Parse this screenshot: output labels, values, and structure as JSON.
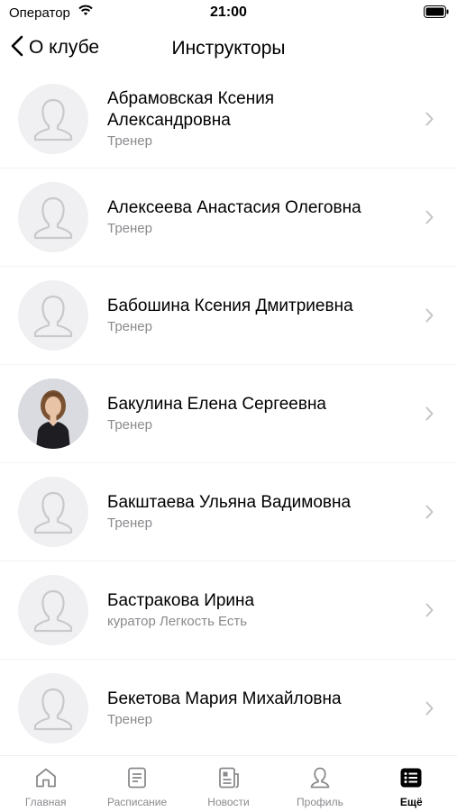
{
  "status_bar": {
    "carrier": "Оператор",
    "time": "21:00"
  },
  "nav": {
    "back_label": "О клубе",
    "title": "Инструкторы"
  },
  "instructors": [
    {
      "name_line1": "Абрамовская Ксения",
      "name_line2": "Александровна",
      "role": "Тренер",
      "avatar": "placeholder-person-icon"
    },
    {
      "name_line1": "Алексеева Анастасия Олеговна",
      "name_line2": "",
      "role": "Тренер",
      "avatar": "placeholder-person-icon"
    },
    {
      "name_line1": "Бабошина Ксения Дмитриевна",
      "name_line2": "",
      "role": "Тренер",
      "avatar": "placeholder-person-icon"
    },
    {
      "name_line1": "Бакулина Елена Сергеевна",
      "name_line2": "",
      "role": "Тренер",
      "avatar": "photo"
    },
    {
      "name_line1": "Бакштаева Ульяна Вадимовна",
      "name_line2": "",
      "role": "Тренер",
      "avatar": "placeholder-person-icon"
    },
    {
      "name_line1": "Бастракова Ирина",
      "name_line2": "",
      "role": "куратор Легкость Есть",
      "avatar": "placeholder-person-icon"
    },
    {
      "name_line1": "Бекетова Мария Михайловна",
      "name_line2": "",
      "role": "Тренер",
      "avatar": "placeholder-person-icon"
    }
  ],
  "tabbar": {
    "items": [
      {
        "label": "Главная",
        "icon": "home-icon"
      },
      {
        "label": "Расписание",
        "icon": "schedule-icon"
      },
      {
        "label": "Новости",
        "icon": "news-icon"
      },
      {
        "label": "Профиль",
        "icon": "profile-icon"
      },
      {
        "label": "Ещё",
        "icon": "more-icon",
        "active": true
      }
    ]
  },
  "colors": {
    "secondary_text": "#8a8a8e",
    "avatar_bg": "#f0f0f2",
    "accent": "#000000"
  }
}
